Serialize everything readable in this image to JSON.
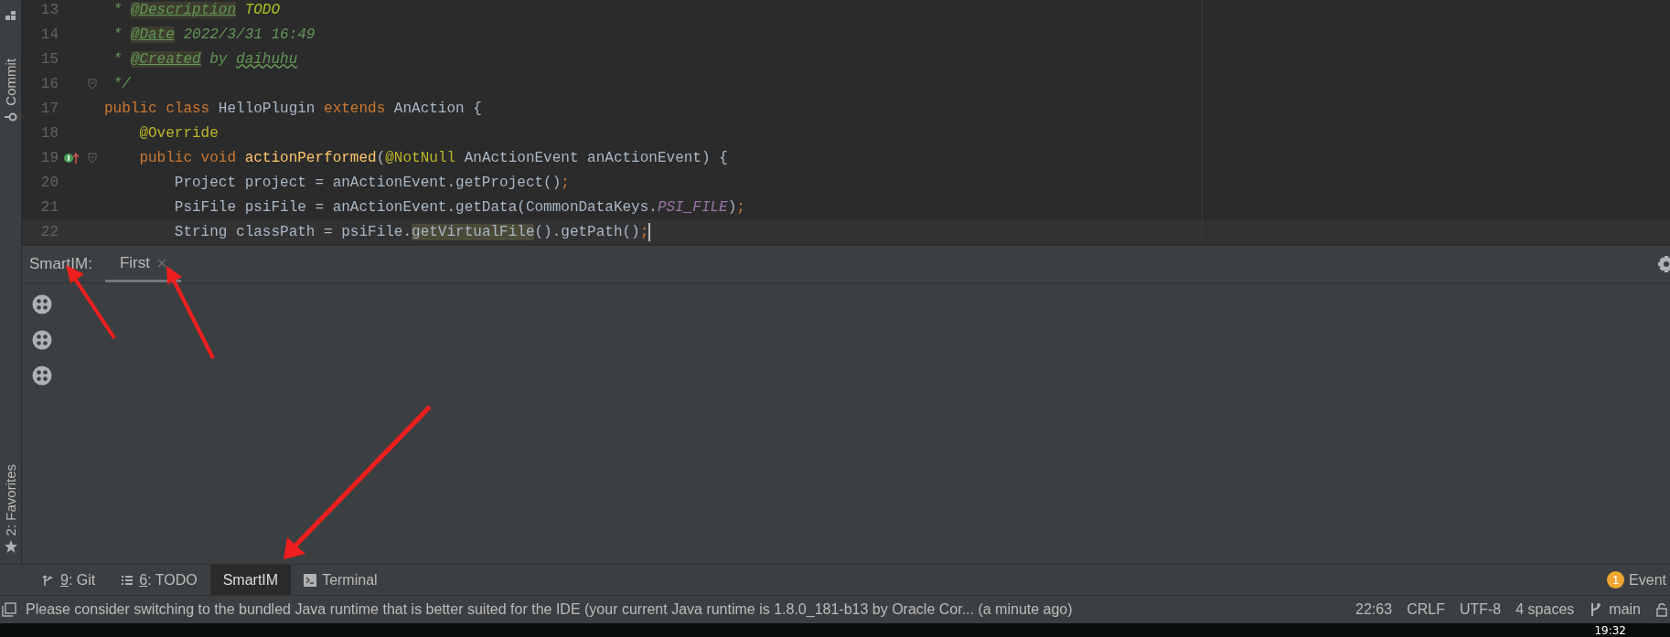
{
  "left_strip": {
    "items": [
      {
        "label": "Commit",
        "kind": "commit"
      },
      {
        "label": "2: Favorites",
        "kind": "favorites"
      }
    ]
  },
  "editor": {
    "lines": [
      {
        "number": "13",
        "current": false,
        "fold": false,
        "marker": false,
        "tokens": [
          {
            "text": " * ",
            "kind": "doc"
          },
          {
            "text": "@Description",
            "kind": "doctag"
          },
          {
            "text": " TODO",
            "kind": "todo"
          }
        ]
      },
      {
        "number": "14",
        "current": false,
        "fold": false,
        "marker": false,
        "tokens": [
          {
            "text": " * ",
            "kind": "doc"
          },
          {
            "text": "@Date",
            "kind": "doctag"
          },
          {
            "text": " 2022/3/31 16:49",
            "kind": "doc"
          }
        ]
      },
      {
        "number": "15",
        "current": false,
        "fold": false,
        "marker": false,
        "tokens": [
          {
            "text": " * ",
            "kind": "doc"
          },
          {
            "text": "@Created",
            "kind": "doctag"
          },
          {
            "text": " by ",
            "kind": "doc"
          },
          {
            "text": "daihuhu",
            "kind": "typo"
          }
        ]
      },
      {
        "number": "16",
        "current": false,
        "fold": true,
        "marker": false,
        "tokens": [
          {
            "text": " */",
            "kind": "doc"
          }
        ]
      },
      {
        "number": "17",
        "current": false,
        "fold": false,
        "marker": false,
        "tokens": [
          {
            "text": "public class ",
            "kind": "keyword"
          },
          {
            "text": "HelloPlugin ",
            "kind": "plain"
          },
          {
            "text": "extends ",
            "kind": "keyword"
          },
          {
            "text": "AnAction {",
            "kind": "plain"
          }
        ]
      },
      {
        "number": "18",
        "current": false,
        "fold": false,
        "marker": false,
        "tokens": [
          {
            "text": "    @Override",
            "kind": "annotation"
          }
        ]
      },
      {
        "number": "19",
        "current": false,
        "fold": true,
        "marker": true,
        "tokens": [
          {
            "text": "    public void ",
            "kind": "keyword"
          },
          {
            "text": "actionPerformed",
            "kind": "method"
          },
          {
            "text": "(",
            "kind": "plain"
          },
          {
            "text": "@NotNull ",
            "kind": "annotation"
          },
          {
            "text": "AnActionEvent anActionEvent) {",
            "kind": "plain"
          }
        ]
      },
      {
        "number": "20",
        "current": false,
        "fold": false,
        "marker": false,
        "tokens": [
          {
            "text": "        Project project = anActionEvent.getProject()",
            "kind": "plain"
          },
          {
            "text": ";",
            "kind": "keyword"
          }
        ]
      },
      {
        "number": "21",
        "current": false,
        "fold": false,
        "marker": false,
        "tokens": [
          {
            "text": "        PsiFile psiFile = anActionEvent.getData(CommonDataKeys.",
            "kind": "plain"
          },
          {
            "text": "PSI_FILE",
            "kind": "constant"
          },
          {
            "text": ")",
            "kind": "plain"
          },
          {
            "text": ";",
            "kind": "keyword"
          }
        ]
      },
      {
        "number": "22",
        "current": true,
        "fold": false,
        "marker": false,
        "tokens": [
          {
            "text": "        String classPath = psiFile.",
            "kind": "plain"
          },
          {
            "text": "getVirtualFile",
            "kind": "highlight"
          },
          {
            "text": "().getPath()",
            "kind": "plain"
          },
          {
            "text": ";",
            "kind": "keyword"
          }
        ]
      }
    ]
  },
  "tool_window": {
    "title": "SmartIM:",
    "tabs": [
      {
        "label": "First",
        "selected": true
      }
    ]
  },
  "bottom_tabs": [
    {
      "label": "9: Git",
      "kind": "git",
      "mnemonic": true,
      "selected": false
    },
    {
      "label": "6: TODO",
      "kind": "todo",
      "mnemonic": true,
      "selected": false
    },
    {
      "label": "SmartIM",
      "kind": "plain",
      "mnemonic": false,
      "selected": true
    },
    {
      "label": "Terminal",
      "kind": "terminal",
      "mnemonic": false,
      "selected": false
    }
  ],
  "event_log": {
    "badge": "1",
    "label": "Event"
  },
  "status_bar": {
    "message": "Please consider switching to the bundled Java runtime that is better suited for the IDE (your current Java runtime is 1.8.0_181-b13 by Oracle Cor... (a minute ago)",
    "position": "22:63",
    "line_separator": "CRLF",
    "encoding": "UTF-8",
    "indent": "4 spaces",
    "branch": "main"
  },
  "taskbar": {
    "clock": "19:32"
  }
}
